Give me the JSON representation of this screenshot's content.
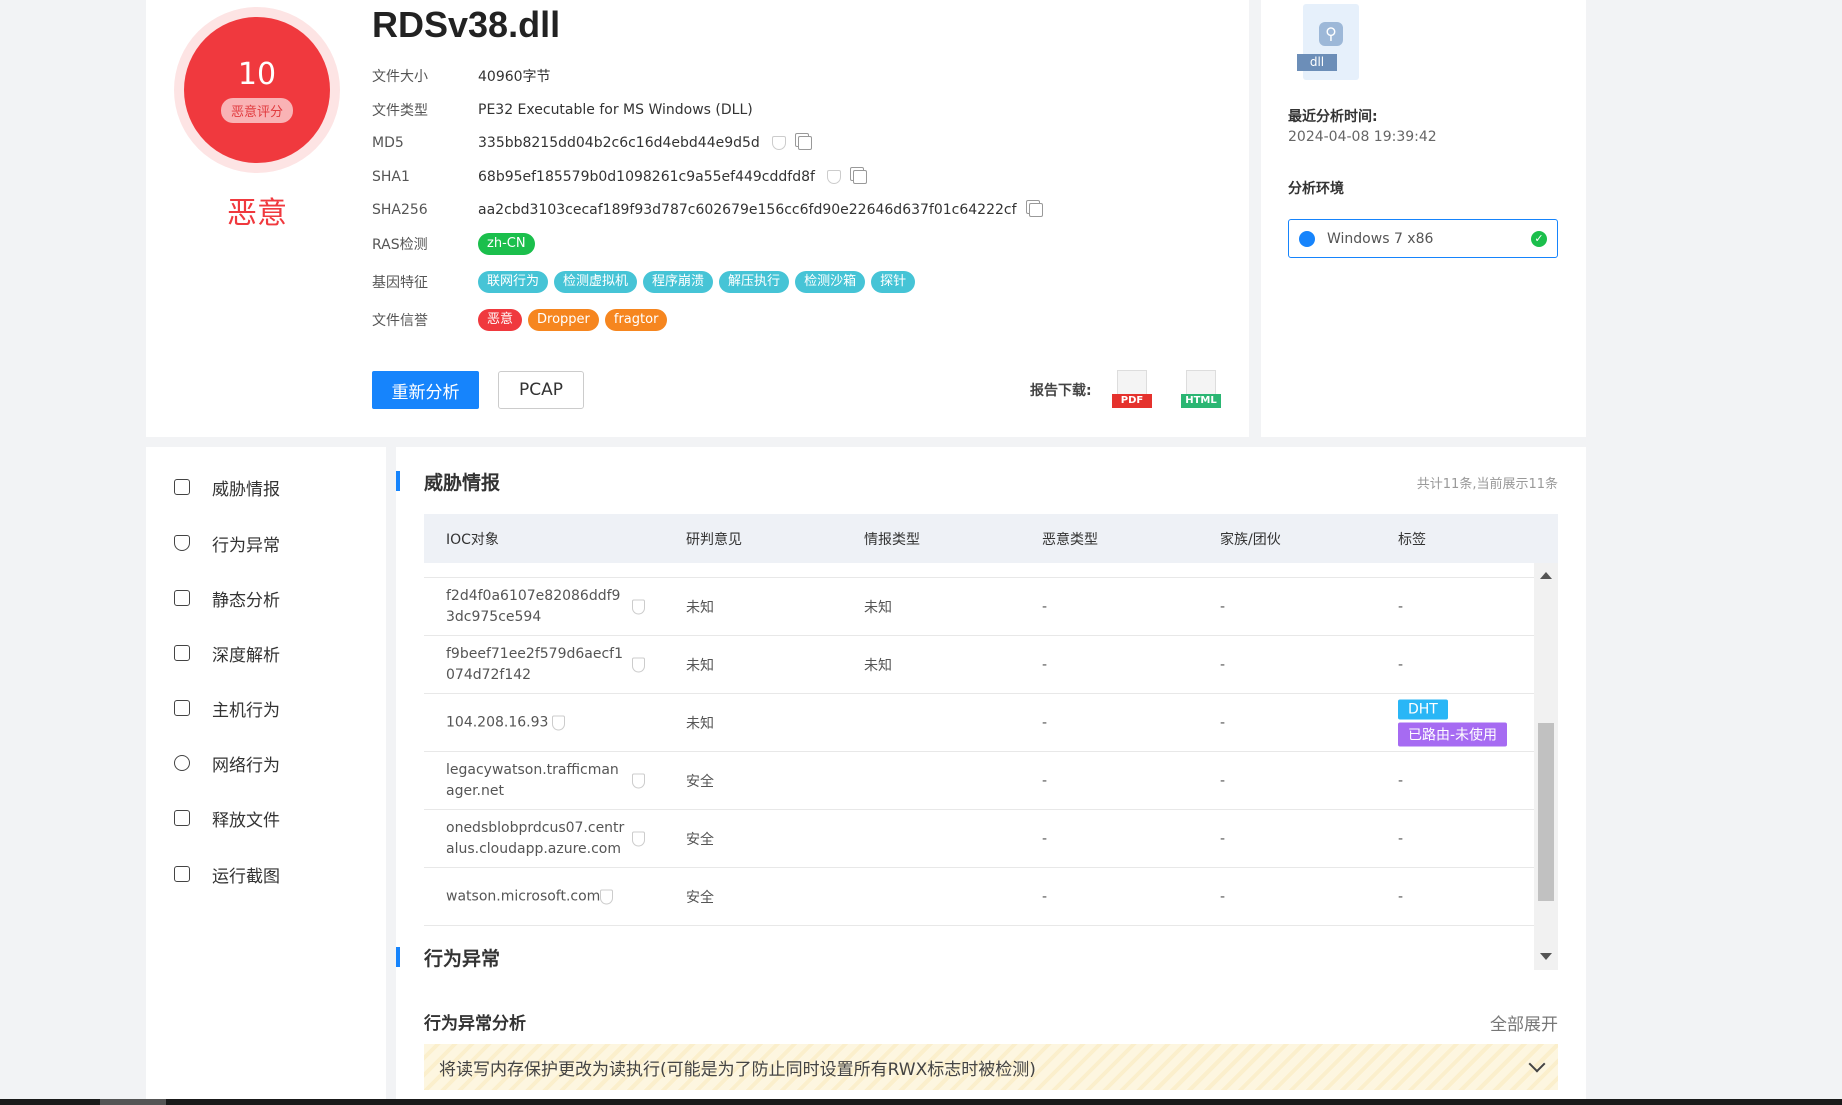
{
  "file": {
    "title": "RDSv38.dll",
    "score": "10",
    "score_label": "恶意评分",
    "verdict": "恶意",
    "rows": [
      {
        "label": "文件大小",
        "value": "40960字节"
      },
      {
        "label": "文件类型",
        "value": "PE32 Executable for MS Windows (DLL)"
      },
      {
        "label": "MD5",
        "value": "335bb8215dd04b2c6c16d4ebd44e9d5d"
      },
      {
        "label": "SHA1",
        "value": "68b95ef185579b0d1098261c9a55ef449cddfd8f"
      },
      {
        "label": "SHA256",
        "value": "aa2cbd3103cecaf189f93d787c602679e156cc6fd90e22646d637f01c64222cf"
      }
    ],
    "ras_label": "RAS检测",
    "ras_tag": "zh-CN",
    "gene_label": "基因特征",
    "gene_tags": [
      "联网行为",
      "检测虚拟机",
      "程序崩溃",
      "解压执行",
      "检测沙箱",
      "探针"
    ],
    "rep_label": "文件信誉",
    "rep_tags": [
      "恶意",
      "Dropper",
      "fragtor"
    ],
    "reanalyze_label": "重新分析",
    "pcap_label": "PCAP",
    "download_label": "报告下载:",
    "pdf_label": "PDF",
    "html_label": "HTML"
  },
  "side": {
    "file_ext": "dll",
    "last_time_label": "最近分析时间:",
    "last_time_value": "2024-04-08 19:39:42",
    "env_label": "分析环境",
    "env_value": "Windows 7 x86",
    "check_glyph": "✓"
  },
  "nav": [
    {
      "label": "威胁情报",
      "icon": "threat-intel-icon"
    },
    {
      "label": "行为异常",
      "icon": "shield-icon"
    },
    {
      "label": "静态分析",
      "icon": "static-analysis-icon"
    },
    {
      "label": "深度解析",
      "icon": "deep-analysis-icon"
    },
    {
      "label": "主机行为",
      "icon": "host-icon"
    },
    {
      "label": "网络行为",
      "icon": "network-icon"
    },
    {
      "label": "释放文件",
      "icon": "file-release-icon"
    },
    {
      "label": "运行截图",
      "icon": "screenshot-icon"
    }
  ],
  "threat": {
    "title": "威胁情报",
    "count": "共计11条,当前展示11条",
    "headers": [
      "IOC对象",
      "研判意见",
      "情报类型",
      "恶意类型",
      "家族/团伙",
      "标签"
    ],
    "rows": [
      {
        "ioc": "f2d4f0a6107e82086ddf93dc975ce594",
        "opinion": "未知",
        "type": "未知",
        "mal": "-",
        "family": "-",
        "tags": []
      },
      {
        "ioc": "f9beef71ee2f579d6aecf1074d72f142",
        "opinion": "未知",
        "type": "未知",
        "mal": "-",
        "family": "-",
        "tags": []
      },
      {
        "ioc": "104.208.16.93",
        "opinion": "未知",
        "type": "",
        "mal": "-",
        "family": "-",
        "tags": [
          "DHT",
          "已路由-未使用"
        ]
      },
      {
        "ioc": "legacywatson.trafficmanager.net",
        "opinion": "安全",
        "type": "",
        "mal": "-",
        "family": "-",
        "tags": []
      },
      {
        "ioc": "onedsblobprdcus07.centralus.cloudapp.azure.com",
        "opinion": "安全",
        "type": "",
        "mal": "-",
        "family": "-",
        "tags": []
      },
      {
        "ioc": "watson.microsoft.com",
        "opinion": "安全",
        "type": "",
        "mal": "-",
        "family": "-",
        "tags": []
      }
    ],
    "empty_dash": "-"
  },
  "behavior": {
    "title": "行为异常",
    "sub_title": "行为异常分析",
    "expand_all": "全部展开",
    "item": "将读写内存保护更改为读执行(可能是为了防止同时设置所有RWX标志时被检测)"
  },
  "colors": {
    "accent": "#1684fc",
    "danger": "#f0393e",
    "success": "#1bbf4c",
    "teal_tag": "#46c4d6",
    "orange_tag": "#f6861f",
    "dht_tag": "#29b6f6",
    "route_tag": "#a66bf2"
  }
}
